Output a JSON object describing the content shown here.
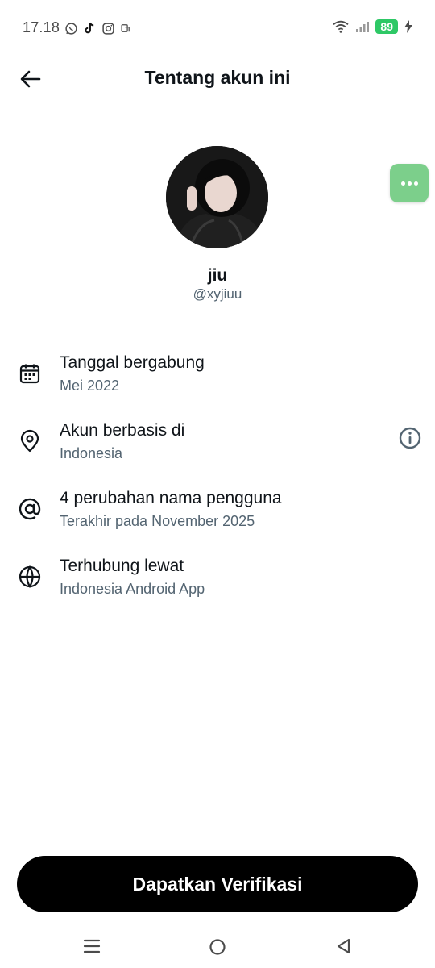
{
  "status_bar": {
    "time": "17.18",
    "battery": "89",
    "notification_icons": [
      "whatsapp-icon",
      "tiktok-icon",
      "instagram-icon",
      "app-icon"
    ]
  },
  "header": {
    "title": "Tentang akun ini"
  },
  "profile": {
    "display_name": "jiu",
    "handle": "@xyjiuu"
  },
  "info_rows": [
    {
      "icon": "calendar-icon",
      "label": "Tanggal bergabung",
      "value": "Mei 2022"
    },
    {
      "icon": "location-pin-icon",
      "label": "Akun berbasis di",
      "value": "Indonesia"
    },
    {
      "icon": "at-sign-icon",
      "label": "4 perubahan nama pengguna",
      "value": "Terakhir pada November 2025"
    },
    {
      "icon": "globe-icon",
      "label": "Terhubung lewat",
      "value": "Indonesia Android App"
    }
  ],
  "cta": {
    "label": "Dapatkan Verifikasi"
  },
  "colors": {
    "text_primary": "#0f1419",
    "text_secondary": "#536471",
    "cta_bg": "#000000",
    "battery": "#2ec866",
    "bubble": "#7ccf8b"
  }
}
